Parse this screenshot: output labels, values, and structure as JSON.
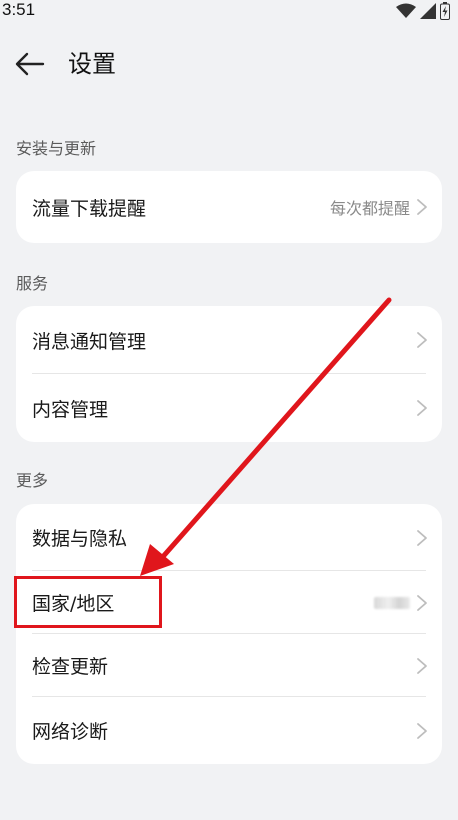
{
  "status_bar": {
    "time": "3:51"
  },
  "header": {
    "title": "设置"
  },
  "sections": [
    {
      "title": "安装与更新",
      "rows": [
        {
          "label": "流量下载提醒",
          "value": "每次都提醒"
        }
      ]
    },
    {
      "title": "服务",
      "rows": [
        {
          "label": "消息通知管理",
          "value": ""
        },
        {
          "label": "内容管理",
          "value": ""
        }
      ]
    },
    {
      "title": "更多",
      "rows": [
        {
          "label": "数据与隐私",
          "value": ""
        },
        {
          "label": "国家/地区",
          "value": ""
        },
        {
          "label": "检查更新",
          "value": ""
        },
        {
          "label": "网络诊断",
          "value": ""
        }
      ]
    }
  ],
  "colors": {
    "highlight": "#e0161c",
    "arrow": "#e0161c"
  }
}
